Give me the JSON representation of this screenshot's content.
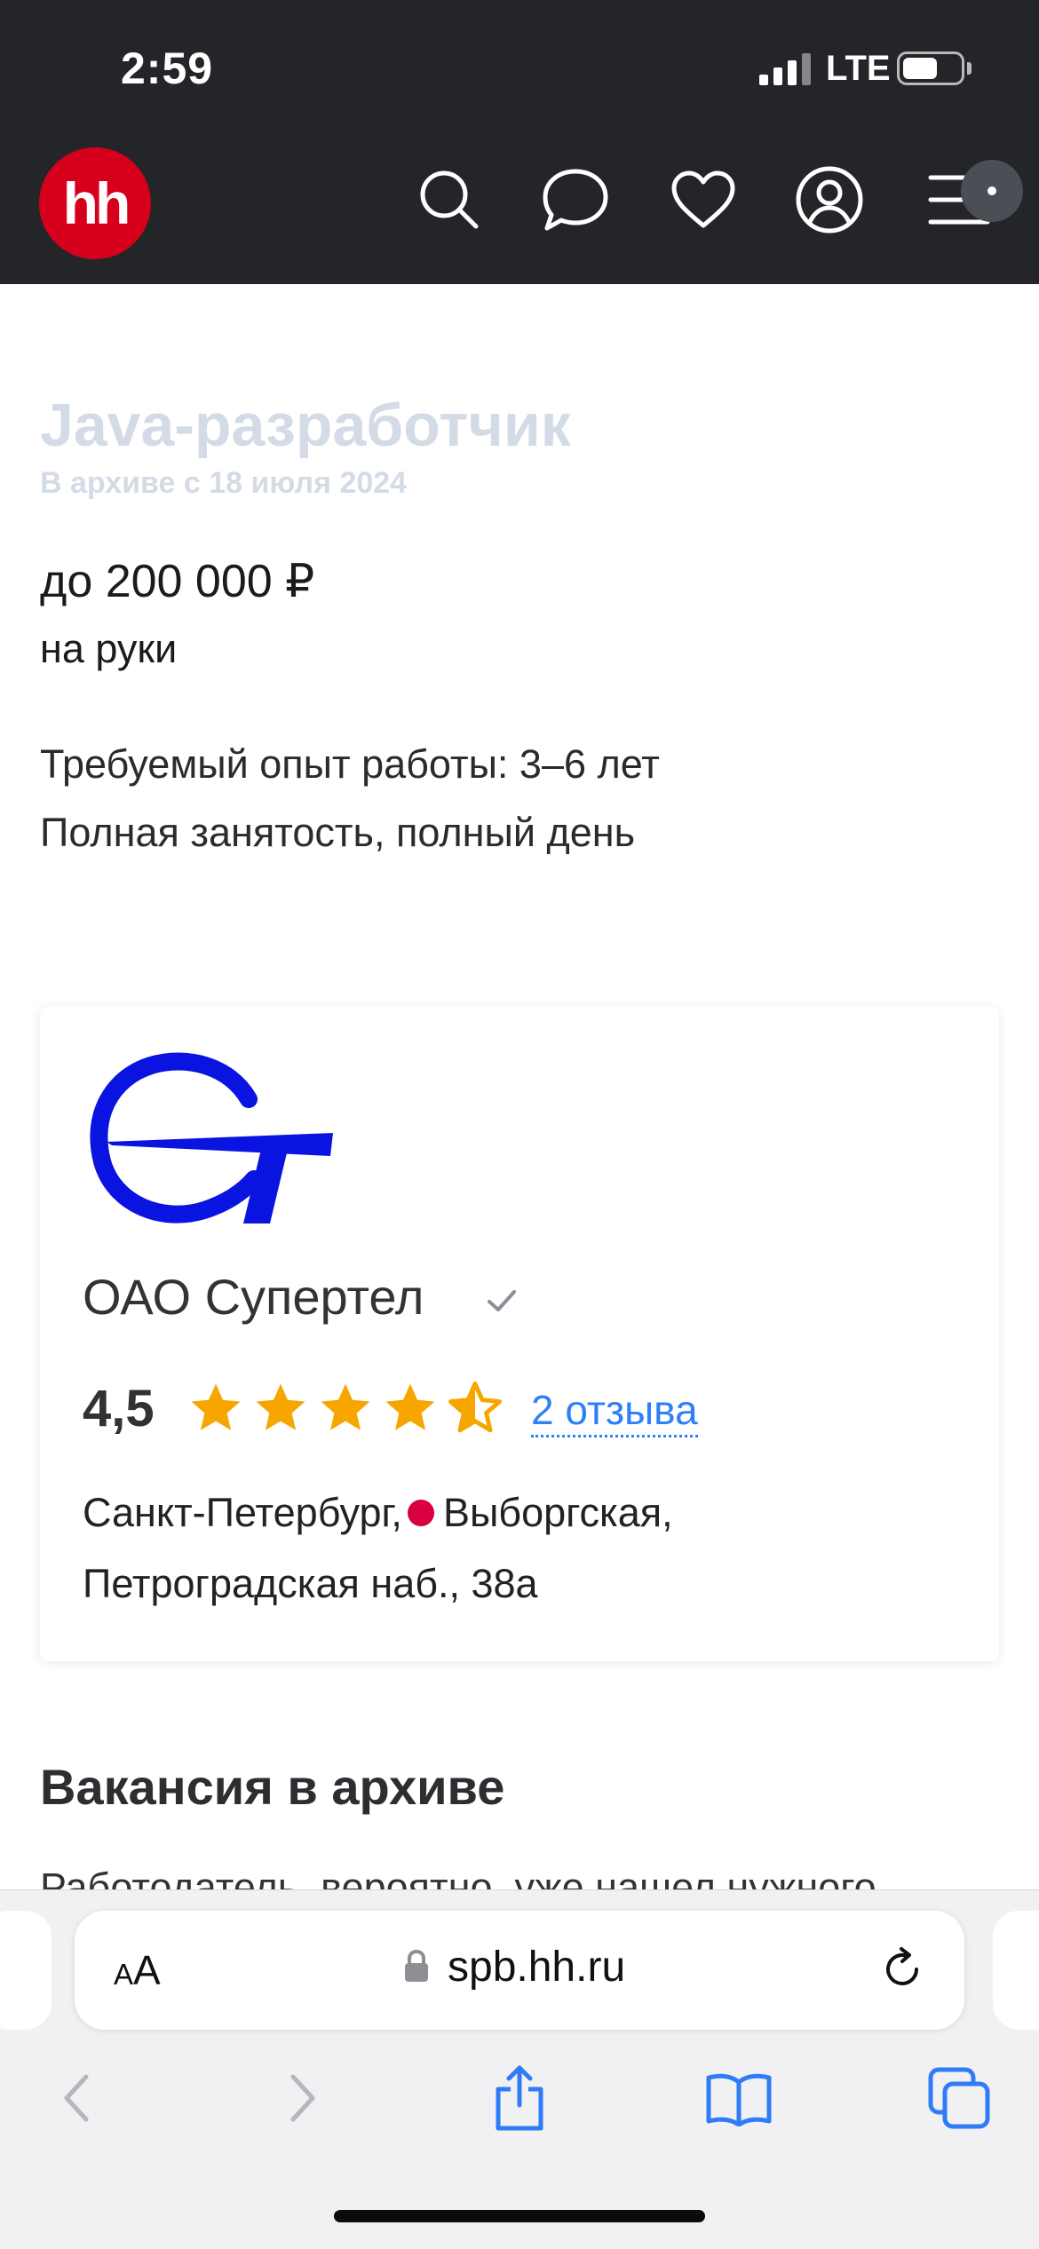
{
  "status_bar": {
    "time": "2:59",
    "carrier": "LTE",
    "battery_percent": 60
  },
  "header": {
    "logo_text": "hh",
    "brand_color": "#d6001c",
    "icons": [
      "search-icon",
      "chat-icon",
      "heart-icon",
      "profile-icon",
      "menu-icon"
    ]
  },
  "vacancy": {
    "title": "Java-разработчик",
    "archived_since": "В архиве с 18 июля 2024",
    "salary": "до 200 000 ₽",
    "salary_note": "на руки",
    "experience": "Требуемый опыт работы: 3–6 лет",
    "employment": "Полная занятость, полный день"
  },
  "company": {
    "name": "ОАО Супертел",
    "rating": "4,5",
    "rating_value": 4.5,
    "reviews": "2 отзыва",
    "city": "Санкт-Петербург,",
    "metro": "Выборгская,",
    "street": "Петроградская наб., 38а",
    "metro_color": "#d8003e"
  },
  "archive": {
    "heading": "Вакансия в архиве",
    "text": "Работодатель, вероятно, уже нашел нужного"
  },
  "browser": {
    "text_size_small": "A",
    "text_size_large": "A",
    "url": "spb.hh.ru",
    "toolbar": [
      "back-icon",
      "forward-icon",
      "share-icon",
      "bookmarks-icon",
      "tabs-icon"
    ]
  }
}
